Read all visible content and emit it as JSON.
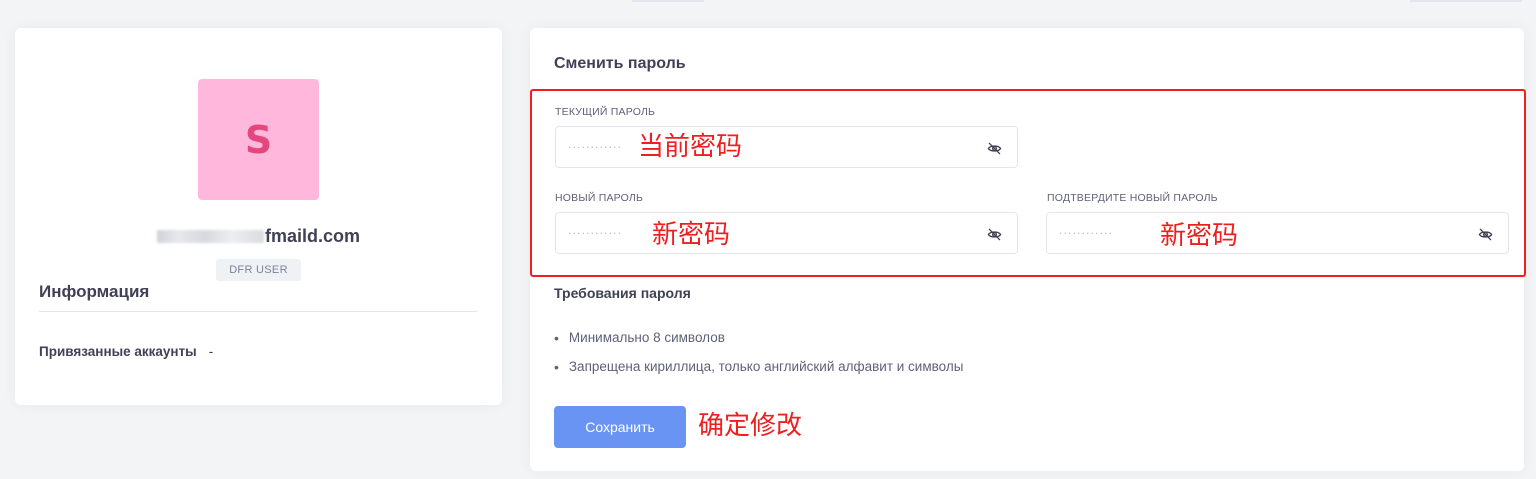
{
  "profile": {
    "avatar_letter": "S",
    "email_visible_part": "fmaild.com",
    "role_badge": "DFR USER",
    "info_title": "Информация",
    "linked_accounts_label": "Привязанные аккаунты",
    "linked_accounts_value": "-"
  },
  "password_form": {
    "title": "Сменить пароль",
    "current_label": "ТЕКУЩИЙ ПАРОЛЬ",
    "current_placeholder": "············",
    "new_label": "НОВЫЙ ПАРОЛЬ",
    "new_placeholder": "············",
    "confirm_label": "ПОДТВЕРДИТЕ НОВЫЙ ПАРОЛЬ",
    "confirm_placeholder": "············",
    "requirements_title": "Требования пароля",
    "requirements": [
      "Минимально 8 символов",
      "Запрещена кириллица, только английский алфавит и символы"
    ],
    "save_label": "Сохранить"
  },
  "annotations": {
    "current": "当前密码",
    "new": "新密码",
    "confirm": "新密码",
    "save": "确定修改"
  },
  "icons": {
    "eye": "eye-slash-icon"
  },
  "colors": {
    "background": "#f3f4f5",
    "avatar_bg": "#ffb8dc",
    "avatar_letter": "#e4477d",
    "primary_button": "#6994f3",
    "annotation_red": "#f01e1e"
  }
}
